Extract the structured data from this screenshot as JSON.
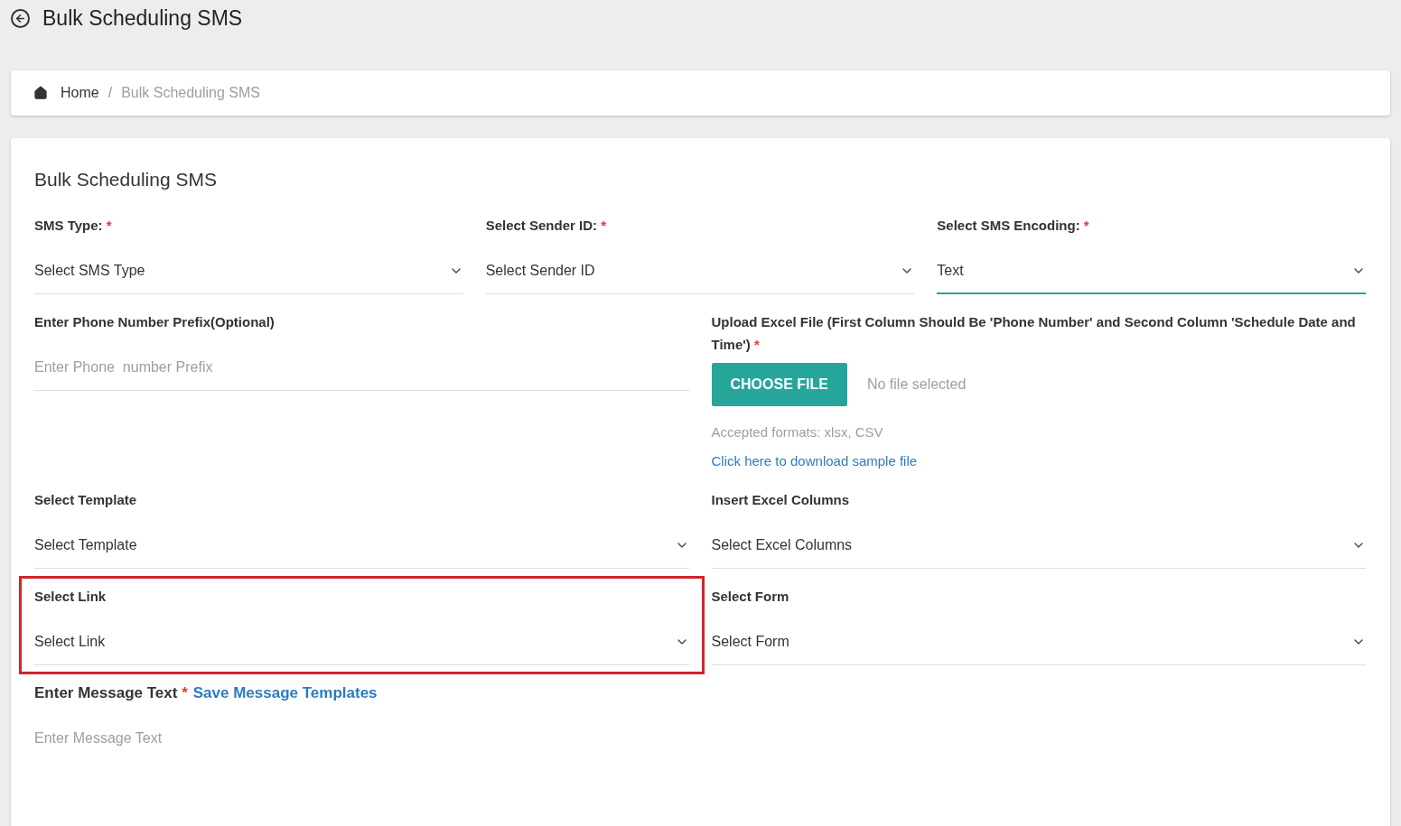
{
  "page": {
    "title": "Bulk Scheduling SMS"
  },
  "breadcrumb": [
    {
      "label": "Home",
      "current": false
    },
    {
      "separator": "/",
      "label": "Bulk Scheduling SMS",
      "current": true
    }
  ],
  "form": {
    "title": "Bulk Scheduling SMS",
    "rows": [
      {
        "fields": [
          {
            "kind": "select",
            "label": "SMS Type:",
            "required_mark": "*",
            "value": "Select SMS Type",
            "focused": false
          },
          {
            "kind": "select",
            "label": "Select Sender ID:",
            "required_mark": "*",
            "value": "Select Sender ID",
            "focused": false
          },
          {
            "kind": "select",
            "label": "Select SMS Encoding:",
            "required_mark": "*",
            "value": "Text",
            "focused": true
          }
        ]
      },
      {
        "fields": [
          {
            "kind": "input",
            "label": "Enter Phone Number Prefix(Optional)",
            "placeholder": "Enter Phone  number Prefix",
            "focused": false
          },
          {
            "kind": "file",
            "label": "Upload Excel File (First Column Should Be 'Phone Number' and Second Column 'Schedule Date and Time')",
            "required_mark": "*",
            "button": "CHOOSE FILE",
            "status": "No file selected",
            "hint": "Accepted formats: xlsx, CSV",
            "link": "Click here to download sample file"
          }
        ]
      },
      {
        "fields": [
          {
            "kind": "select",
            "label": "Select Template",
            "value": "Select Template",
            "focused": false
          },
          {
            "kind": "select",
            "label": "Insert Excel Columns",
            "value": "Select Excel Columns",
            "focused": false
          }
        ]
      },
      {
        "fields": [
          {
            "kind": "select",
            "label": "Select Link",
            "value": "Select Link",
            "focused": false,
            "highlighted": true
          },
          {
            "kind": "select",
            "label": "Select Form",
            "value": "Select Form",
            "focused": false
          }
        ]
      }
    ],
    "message": {
      "label": "Enter Message Text",
      "required_mark": "*",
      "link": "Save Message Templates",
      "placeholder": "Enter Message Text"
    }
  }
}
